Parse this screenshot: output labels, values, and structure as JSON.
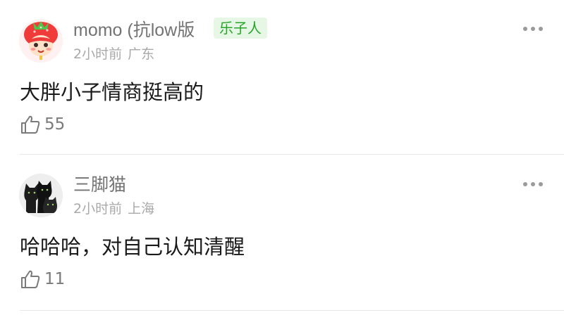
{
  "comments": [
    {
      "author": "momo (抗low版",
      "badge": "乐子人",
      "time": "2小时前",
      "location": "广东",
      "text": "大胖小子情商挺高的",
      "likes": "55",
      "avatar_icon": "strawberry-girl-avatar",
      "badge_color": "#28a428"
    },
    {
      "author": "三脚猫",
      "time": "2小时前",
      "location": "上海",
      "text": "哈哈哈，对自己认知清醒",
      "likes": "11",
      "avatar_icon": "black-cats-avatar"
    }
  ]
}
